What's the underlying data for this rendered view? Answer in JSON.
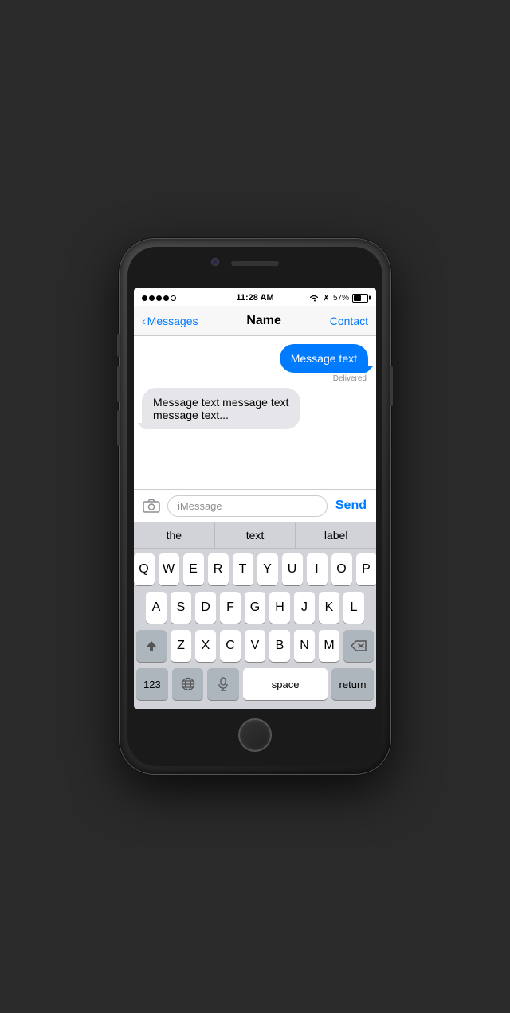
{
  "phone": {
    "status_bar": {
      "time": "11:28 AM",
      "battery_percent": "57%",
      "signal_dots": 4
    },
    "nav": {
      "back_label": "Messages",
      "title": "Name",
      "contact_label": "Contact"
    },
    "messages": [
      {
        "type": "sent",
        "text": "Message text",
        "status": "Delivered"
      },
      {
        "type": "received",
        "text": "Message text message text message text..."
      }
    ],
    "input": {
      "placeholder": "iMessage",
      "send_label": "Send"
    },
    "autocomplete": [
      "the",
      "text",
      "label"
    ],
    "keyboard": {
      "rows": [
        [
          "Q",
          "W",
          "E",
          "R",
          "T",
          "Y",
          "U",
          "I",
          "O",
          "P"
        ],
        [
          "A",
          "S",
          "D",
          "F",
          "G",
          "H",
          "J",
          "K",
          "L"
        ],
        [
          "Z",
          "X",
          "C",
          "V",
          "B",
          "N",
          "M"
        ],
        [
          "123",
          "🌐",
          "space",
          "return"
        ]
      ]
    }
  }
}
